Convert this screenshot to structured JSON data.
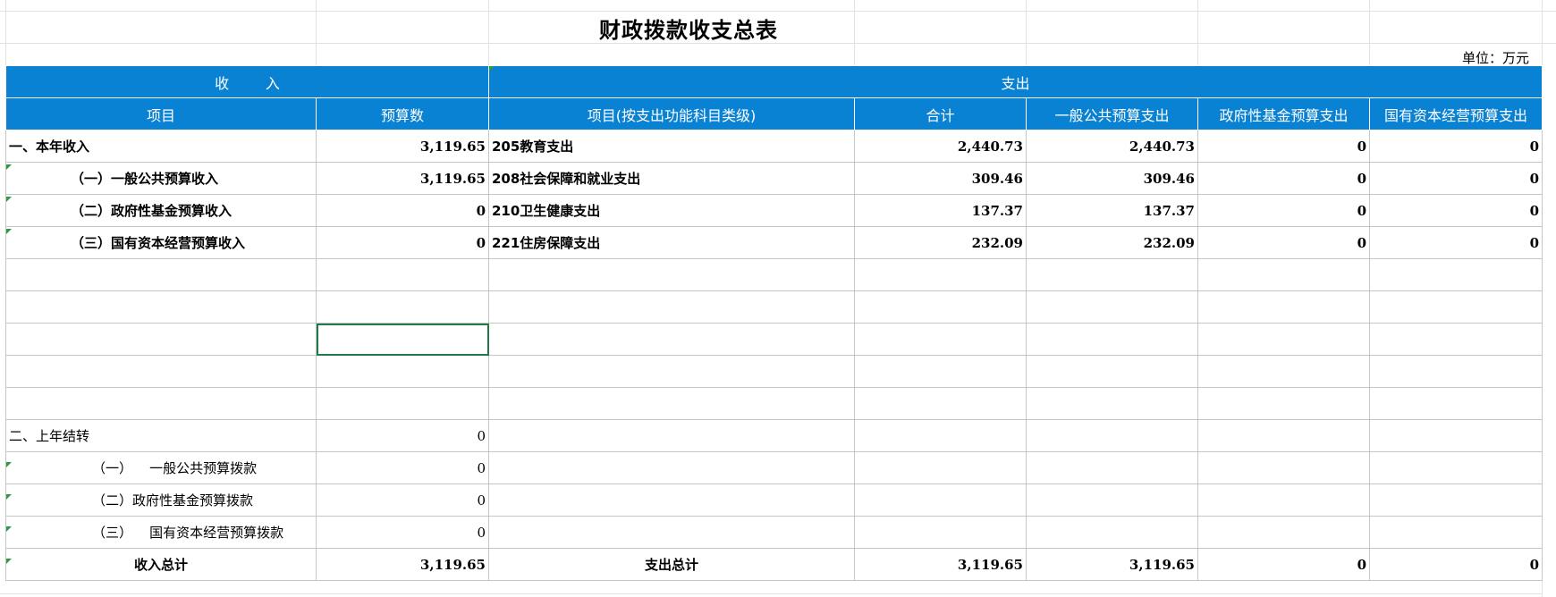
{
  "title": "财政拨款收支总表",
  "unit": "单位：万元",
  "headers": {
    "income_group": "收        入",
    "expense_group": "支出",
    "item": "项目",
    "budget": "预算数",
    "expense_item": "项目(按支出功能科目类级)",
    "total": "合计",
    "general": "一般公共预算支出",
    "fund": "政府性基金预算支出",
    "state": "国有资本经营预算支出"
  },
  "income": [
    {
      "label": "一、本年收入",
      "value": "3,119.65"
    },
    {
      "label": "（一）一般公共预算收入",
      "value": "3,119.65"
    },
    {
      "label": "（二）政府性基金预算收入",
      "value": "0"
    },
    {
      "label": "（三）国有资本经营预算收入",
      "value": "0"
    },
    {
      "label": "二、上年结转",
      "value": "0"
    },
    {
      "label": "（一）    一般公共预算拨款",
      "value": "0"
    },
    {
      "label": "（二）政府性基金预算拨款",
      "value": "0"
    },
    {
      "label": "（三）    国有资本经营预算拨款",
      "value": "0"
    }
  ],
  "expense": [
    {
      "label": "205教育支出",
      "total": "2,440.73",
      "general": "2,440.73",
      "fund": "0",
      "state": "0"
    },
    {
      "label": "208社会保障和就业支出",
      "total": "309.46",
      "general": "309.46",
      "fund": "0",
      "state": "0"
    },
    {
      "label": "210卫生健康支出",
      "total": "137.37",
      "general": "137.37",
      "fund": "0",
      "state": "0"
    },
    {
      "label": "221住房保障支出",
      "total": "232.09",
      "general": "232.09",
      "fund": "0",
      "state": "0"
    }
  ],
  "totals": {
    "income_label": "收入总计",
    "income_value": "3,119.65",
    "expense_label": "支出总计",
    "total": "3,119.65",
    "general": "3,119.65",
    "fund": "0",
    "state": "0"
  }
}
